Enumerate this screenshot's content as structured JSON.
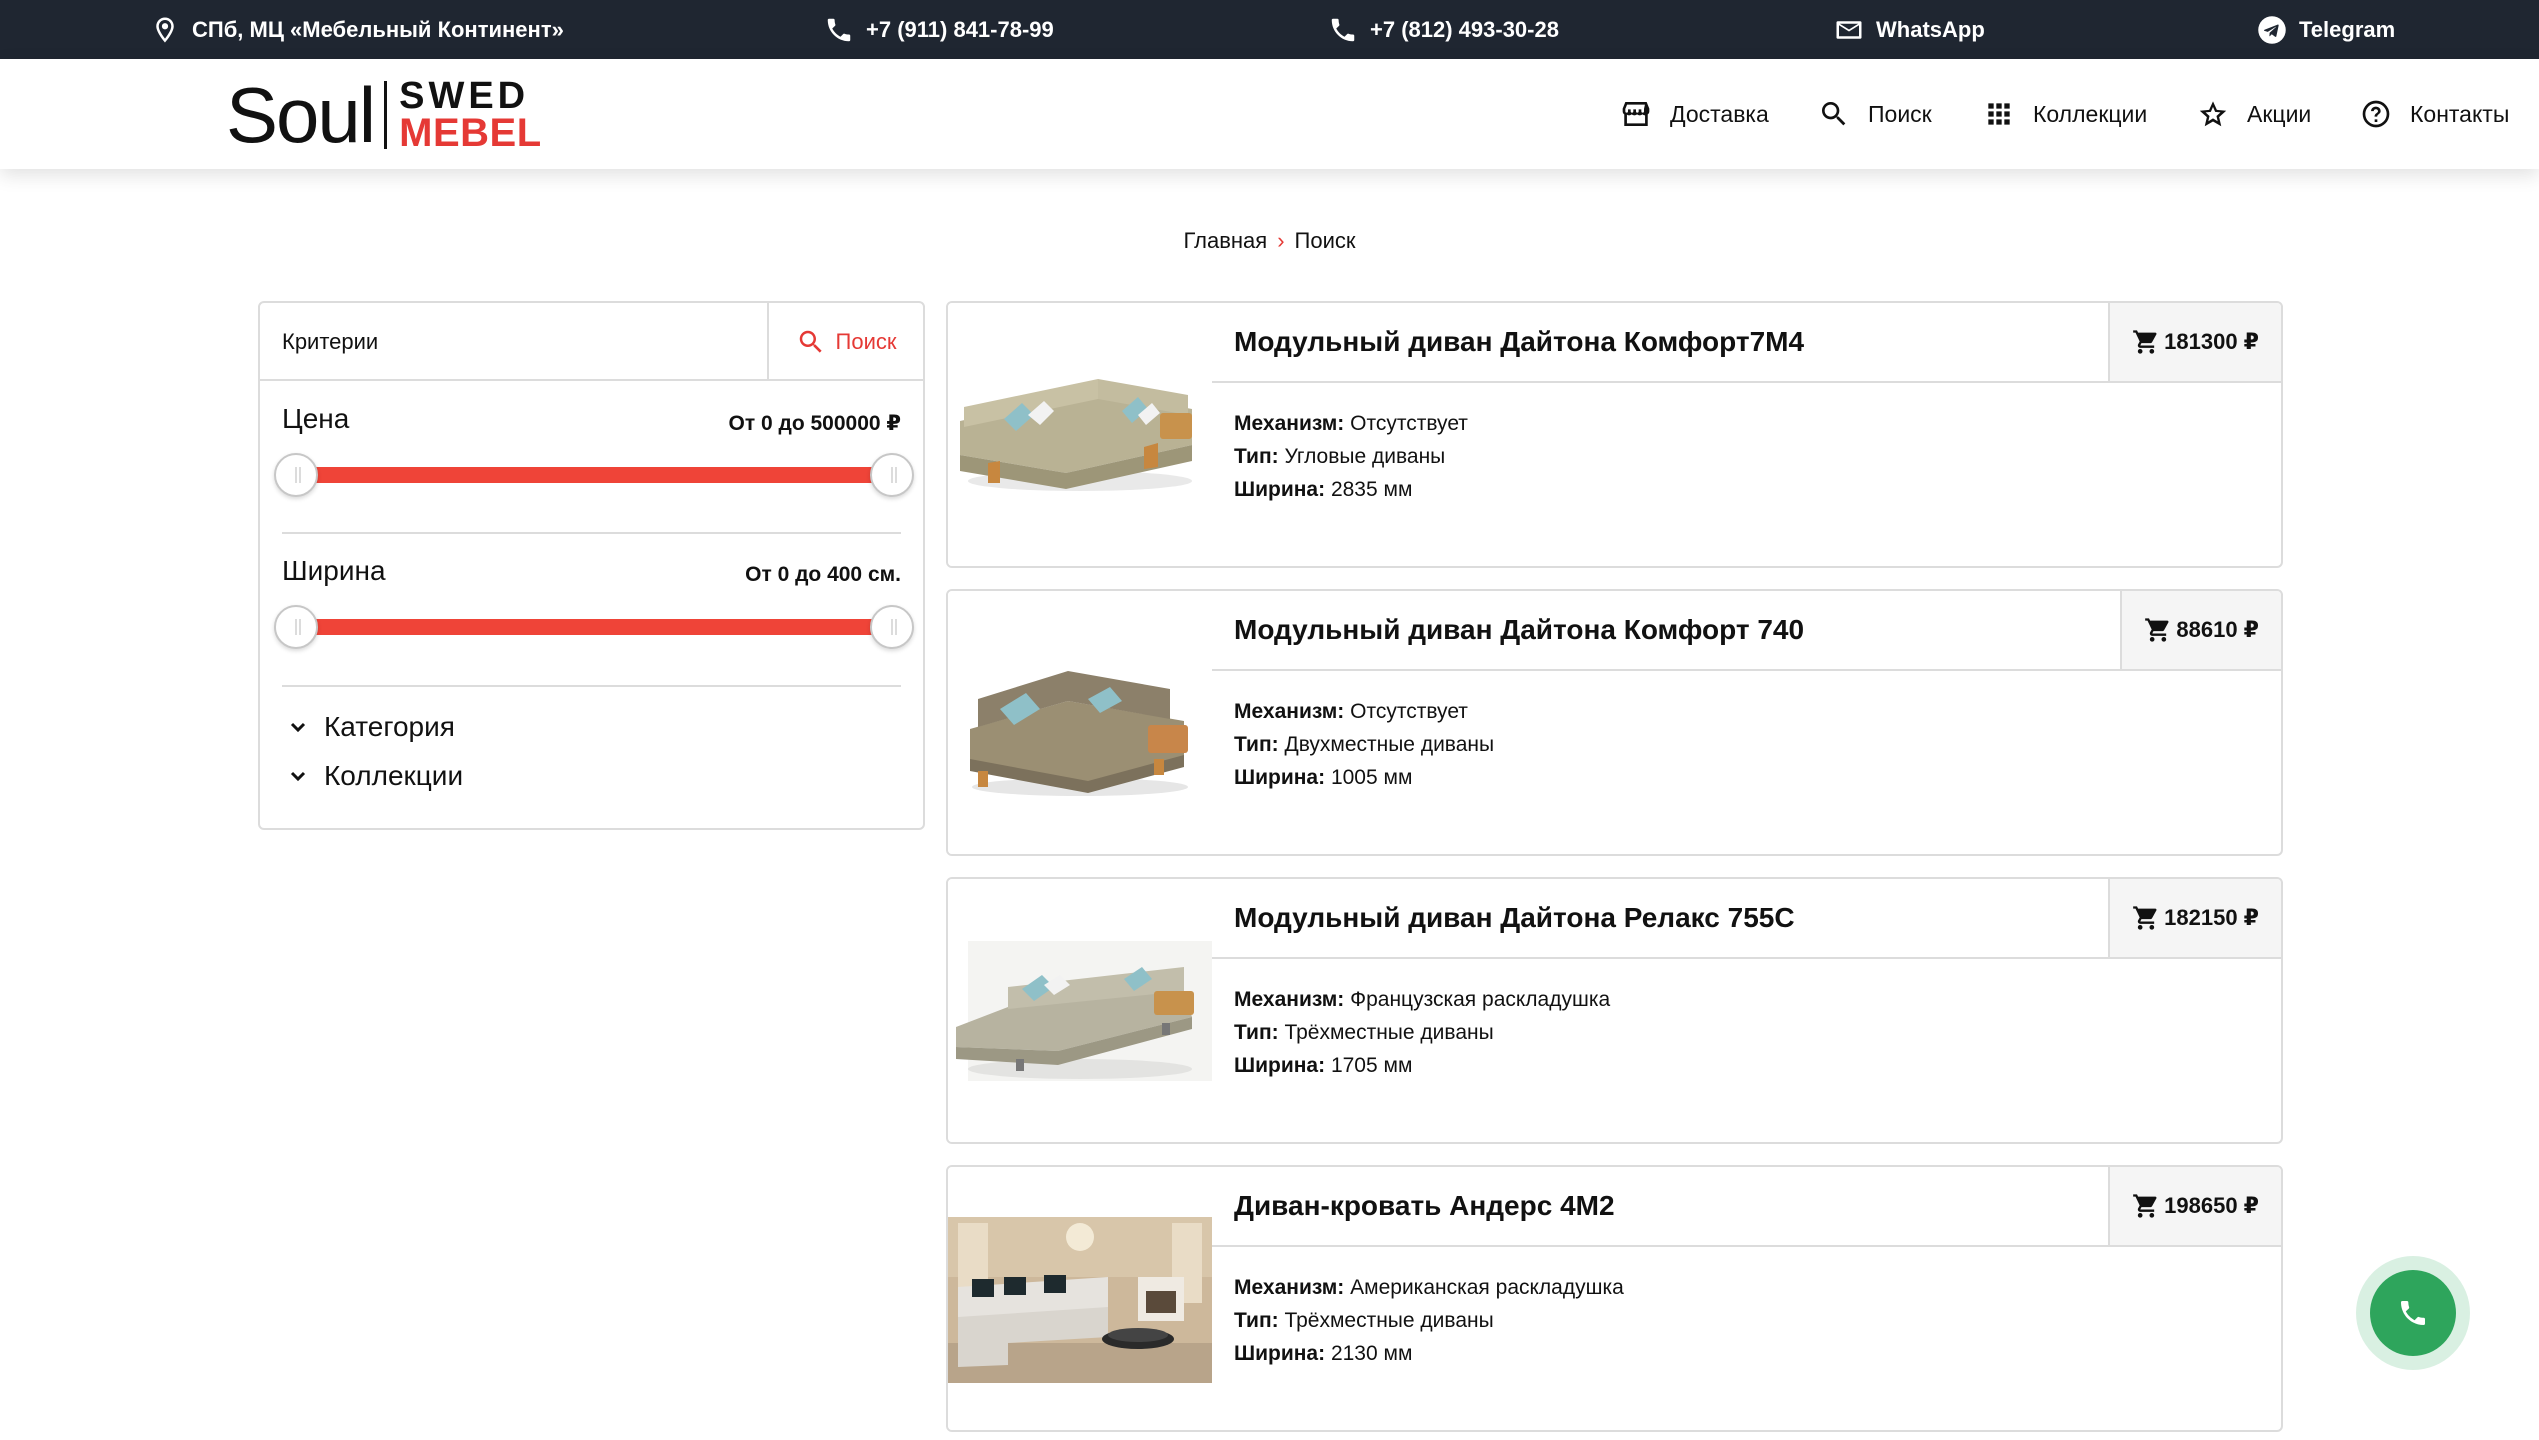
{
  "topbar": {
    "address": "СПб, МЦ «Мебельный Континент»",
    "phone1": "+7 (911) 841-78-99",
    "phone2": "+7 (812) 493-30-28",
    "whatsapp": "WhatsApp",
    "telegram": "Telegram"
  },
  "logo": {
    "soul": "Soul",
    "swed": "SWED",
    "mebel": "MEBEL"
  },
  "nav": {
    "delivery": "Доставка",
    "search": "Поиск",
    "collections": "Коллекции",
    "promo": "Акции",
    "contacts": "Контакты"
  },
  "breadcrumb": {
    "home": "Главная",
    "current": "Поиск"
  },
  "filter": {
    "criteria_label": "Критерии",
    "search_button": "Поиск",
    "price": {
      "title": "Цена",
      "range_text": "От 0 до 500000 ₽",
      "min": 0,
      "max": 500000
    },
    "width": {
      "title": "Ширина",
      "range_text": "От 0 до 400 см.",
      "min": 0,
      "max": 400
    },
    "category": "Категория",
    "collections": "Коллекции"
  },
  "labels": {
    "mechanism": "Механизм:",
    "type": "Тип:",
    "width": "Ширина:"
  },
  "products": [
    {
      "title": "Модульный диван Дайтона Комфорт7М4",
      "price": "181300 ₽",
      "mechanism": "Отсутствует",
      "type": "Угловые диваны",
      "width": "2835 мм"
    },
    {
      "title": "Модульный диван Дайтона Комфорт 740",
      "price": "88610 ₽",
      "mechanism": "Отсутствует",
      "type": "Двухместные диваны",
      "width": "1005 мм"
    },
    {
      "title": "Модульный диван Дайтона Релакс 755С",
      "price": "182150 ₽",
      "mechanism": "Французская раскладушка",
      "type": "Трёхместные диваны",
      "width": "1705 мм"
    },
    {
      "title": "Диван-кровать Андерс 4М2",
      "price": "198650 ₽",
      "mechanism": "Американская раскладушка",
      "type": "Трёхместные диваны",
      "width": "2130 мм"
    }
  ],
  "colors": {
    "topbar": "#1f2631",
    "accent": "#e53935",
    "slider": "#ef4438",
    "call": "#2ea55c"
  }
}
